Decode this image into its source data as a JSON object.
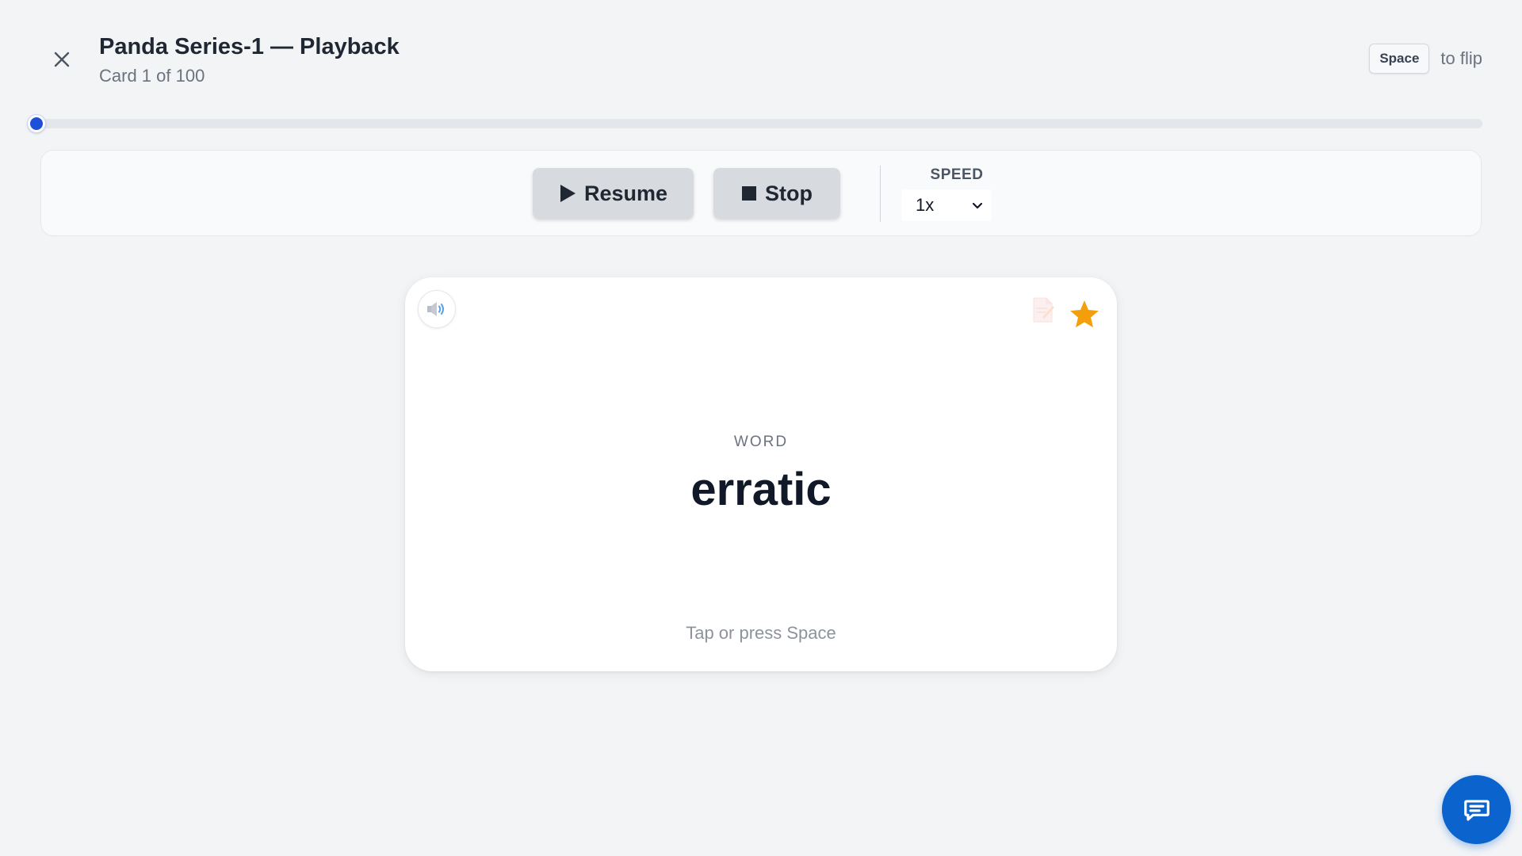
{
  "header": {
    "title": "Panda Series-1 — Playback",
    "subtitle": "Card 1 of 100",
    "close_icon": "close-icon"
  },
  "flip_hint": {
    "key": "Space",
    "text": "to flip"
  },
  "progress": {
    "current": 1,
    "total": 100,
    "fraction": 0.0,
    "color": "#1e4fd8"
  },
  "controls": {
    "resume_label": "Resume",
    "resume_icon": "play-icon",
    "stop_label": "Stop",
    "stop_icon": "stop-icon",
    "speed_label": "SPEED",
    "speed_value": "1x"
  },
  "card": {
    "audio_icon": "speaker-icon",
    "note_icon": "note-icon",
    "star_icon": "star-icon",
    "starred": true,
    "star_color": "#f59e0b",
    "face_label": "WORD",
    "word": "erratic",
    "hint": "Tap or press Space"
  },
  "chat": {
    "icon": "chat-icon",
    "color": "#0b63ce"
  }
}
